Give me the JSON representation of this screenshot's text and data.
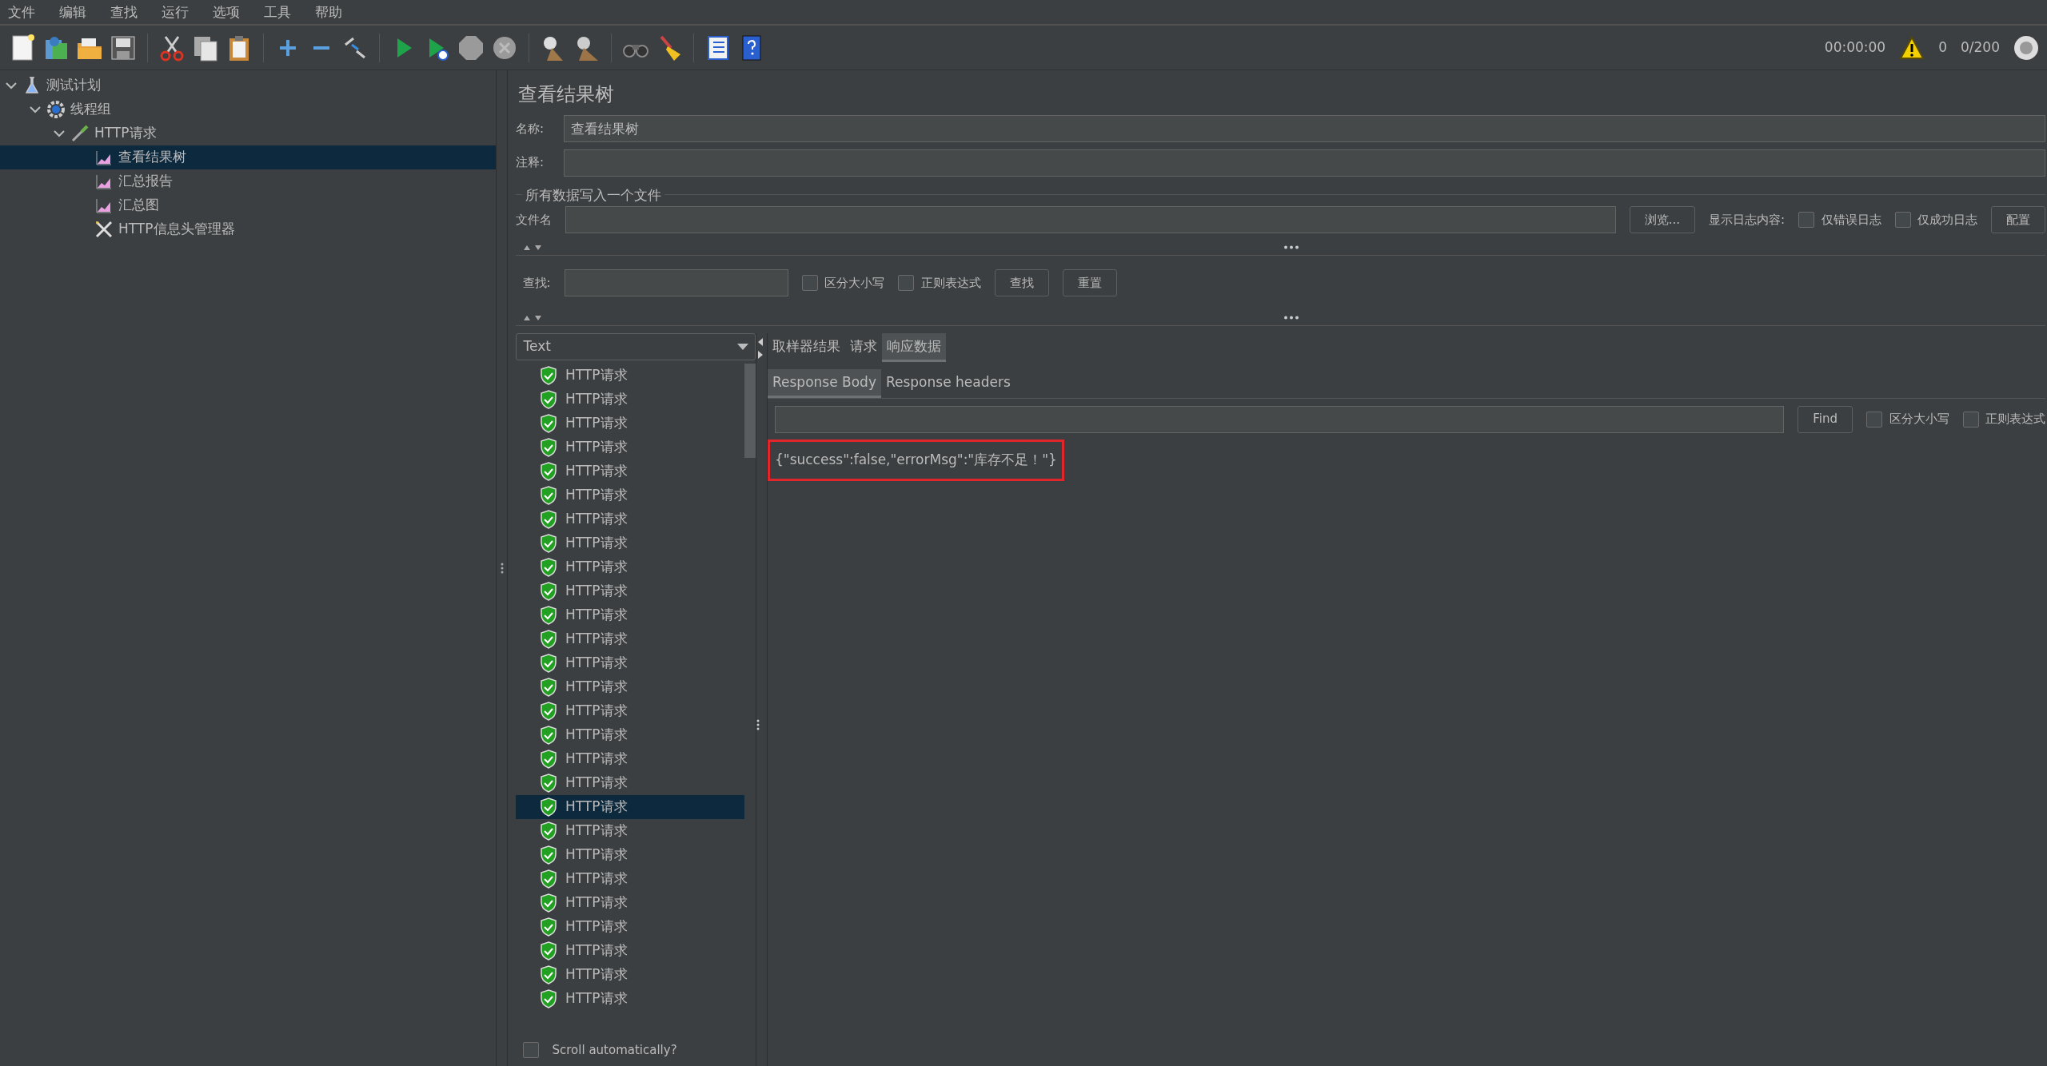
{
  "menu": [
    "文件",
    "编辑",
    "查找",
    "运行",
    "选项",
    "工具",
    "帮助"
  ],
  "toolbar": {
    "timer": "00:00:00",
    "warnings": "0",
    "threads": "0/200"
  },
  "tree": [
    {
      "label": "测试计划",
      "kind": "plan",
      "selected": false,
      "expanded": true,
      "children": [
        {
          "label": "线程组",
          "kind": "threads",
          "selected": false,
          "expanded": true,
          "children": [
            {
              "label": "HTTP请求",
              "kind": "sampler",
              "selected": false,
              "expanded": true,
              "children": [
                {
                  "label": "查看结果树",
                  "kind": "listener",
                  "selected": true
                },
                {
                  "label": "汇总报告",
                  "kind": "listener",
                  "selected": false
                },
                {
                  "label": "汇总图",
                  "kind": "listener",
                  "selected": false
                },
                {
                  "label": "HTTP信息头管理器",
                  "kind": "config",
                  "selected": false
                }
              ]
            }
          ]
        }
      ]
    }
  ],
  "panel": {
    "title": "查看结果树",
    "name_label": "名称:",
    "name_value": "查看结果树",
    "comment_label": "注释:",
    "file_section": {
      "legend": "所有数据写入一个文件",
      "file_label": "文件名",
      "browse_button": "浏览...",
      "log_label": "显示日志内容:",
      "checkboxes": [
        {
          "label": "仅错误日志",
          "checked": false
        },
        {
          "label": "仅成功日志",
          "checked": false
        }
      ],
      "configure_button": "配置"
    },
    "search": {
      "label": "查找:",
      "checkboxes": [
        {
          "label": "区分大小写",
          "checked": false
        },
        {
          "label": "正则表达式",
          "checked": false
        }
      ],
      "find_button": "查找",
      "reset_button": "重置"
    }
  },
  "results": {
    "renderer": "Text",
    "items": [
      {
        "label": "HTTP请求",
        "selected": false
      },
      {
        "label": "HTTP请求",
        "selected": false
      },
      {
        "label": "HTTP请求",
        "selected": false
      },
      {
        "label": "HTTP请求",
        "selected": false
      },
      {
        "label": "HTTP请求",
        "selected": false
      },
      {
        "label": "HTTP请求",
        "selected": false
      },
      {
        "label": "HTTP请求",
        "selected": false
      },
      {
        "label": "HTTP请求",
        "selected": false
      },
      {
        "label": "HTTP请求",
        "selected": false
      },
      {
        "label": "HTTP请求",
        "selected": false
      },
      {
        "label": "HTTP请求",
        "selected": false
      },
      {
        "label": "HTTP请求",
        "selected": false
      },
      {
        "label": "HTTP请求",
        "selected": false
      },
      {
        "label": "HTTP请求",
        "selected": false
      },
      {
        "label": "HTTP请求",
        "selected": false
      },
      {
        "label": "HTTP请求",
        "selected": false
      },
      {
        "label": "HTTP请求",
        "selected": false
      },
      {
        "label": "HTTP请求",
        "selected": false
      },
      {
        "label": "HTTP请求",
        "selected": true
      },
      {
        "label": "HTTP请求",
        "selected": false
      },
      {
        "label": "HTTP请求",
        "selected": false
      },
      {
        "label": "HTTP请求",
        "selected": false
      },
      {
        "label": "HTTP请求",
        "selected": false
      },
      {
        "label": "HTTP请求",
        "selected": false
      },
      {
        "label": "HTTP请求",
        "selected": false
      },
      {
        "label": "HTTP请求",
        "selected": false
      },
      {
        "label": "HTTP请求",
        "selected": false
      }
    ],
    "scroll_auto": {
      "label": "Scroll automatically?",
      "checked": false
    }
  },
  "result_tabs": [
    {
      "label": "取样器结果",
      "selected": false
    },
    {
      "label": "请求",
      "selected": false
    },
    {
      "label": "响应数据",
      "selected": true
    }
  ],
  "body_tabs": [
    {
      "label": "Response Body",
      "selected": true
    },
    {
      "label": "Response headers",
      "selected": false
    }
  ],
  "body_search": {
    "find_button": "Find",
    "checkboxes": [
      {
        "label": "区分大小写",
        "checked": false
      },
      {
        "label": "正则表达式",
        "checked": false
      }
    ]
  },
  "response_text": "{\"success\":false,\"errorMsg\":\"库存不足！\"}"
}
